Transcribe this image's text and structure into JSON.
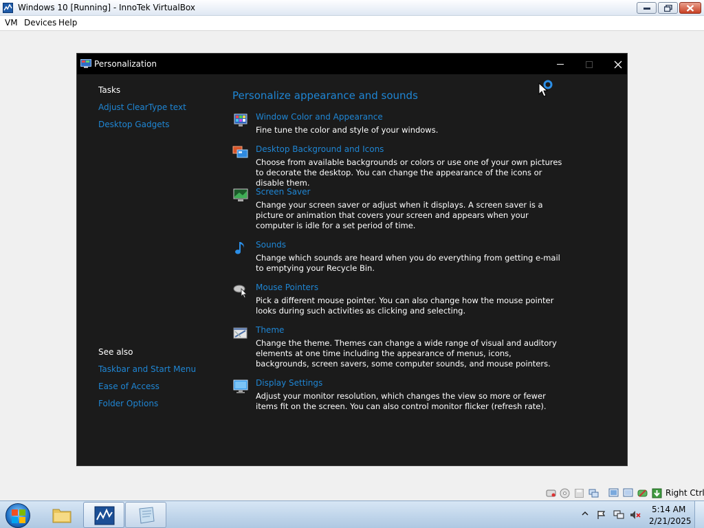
{
  "host": {
    "title": "Windows 10 [Running] - InnoTek VirtualBox",
    "menu": [
      "VM",
      "Devices",
      "Help"
    ],
    "host_key": "Right Ctrl"
  },
  "window": {
    "title": "Personalization"
  },
  "left_pane": {
    "tasks_heading": "Tasks",
    "tasks": [
      "Adjust ClearType text",
      "Desktop Gadgets"
    ],
    "see_also_heading": "See also",
    "see_also": [
      "Taskbar and Start Menu",
      "Ease of Access",
      "Folder Options"
    ]
  },
  "main": {
    "title": "Personalize appearance and sounds",
    "items": [
      {
        "icon": "window-color-icon",
        "title": "Window Color and Appearance",
        "desc": "Fine tune the color and style of your windows."
      },
      {
        "icon": "desktop-background-icon",
        "title": "Desktop Background and Icons",
        "desc": "Choose from available backgrounds or colors or use one of your own pictures to decorate the desktop. You can change the appearance of the icons or disable them."
      },
      {
        "icon": "screen-saver-icon",
        "title": "Screen Saver",
        "desc": "Change your screen saver or adjust when it displays. A screen saver is a picture or animation that covers your screen and appears when your computer is idle for a set period of time."
      },
      {
        "icon": "music-note-icon",
        "title": "Sounds",
        "desc": "Change which sounds are heard when you do everything from getting e-mail to emptying your Recycle Bin."
      },
      {
        "icon": "mouse-pointer-icon",
        "title": "Mouse Pointers",
        "desc": "Pick a different mouse pointer. You can also change how the mouse pointer looks during such activities as clicking and selecting."
      },
      {
        "icon": "theme-icon",
        "title": "Theme",
        "desc": "Change the theme. Themes can change a wide range of visual and auditory elements at one time including the appearance of menus, icons, backgrounds, screen savers, some computer sounds, and mouse pointers."
      },
      {
        "icon": "display-settings-icon",
        "title": "Display Settings",
        "desc": "Adjust your monitor resolution, which changes the view so more or fewer items fit on the screen. You can also control monitor flicker (refresh rate)."
      }
    ]
  },
  "taskbar": {
    "time": "5:14 AM",
    "date": "2/21/2025"
  },
  "colors": {
    "link": "#1f86d4",
    "window_bg": "#1b1b1b",
    "titlebar": "#000000",
    "text": "#ffffff"
  }
}
